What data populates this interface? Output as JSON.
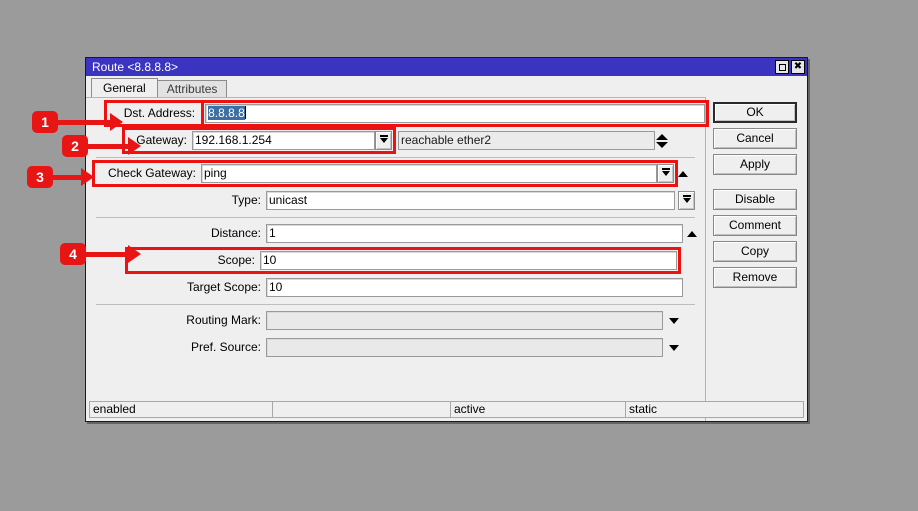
{
  "window": {
    "title": "Route <8.8.8.8>",
    "buttons": {
      "restore": "restore-window",
      "close": "✖"
    }
  },
  "tabs": [
    {
      "label": "General",
      "active": true
    },
    {
      "label": "Attributes",
      "active": false
    }
  ],
  "form": {
    "dst_address": {
      "label": "Dst. Address:",
      "value": "8.8.8.8",
      "selected": true
    },
    "gateway": {
      "label": "Gateway:",
      "value": "192.168.1.254",
      "status": "reachable ether2"
    },
    "check_gateway": {
      "label": "Check Gateway:",
      "value": "ping"
    },
    "type": {
      "label": "Type:",
      "value": "unicast"
    },
    "distance": {
      "label": "Distance:",
      "value": "1"
    },
    "scope": {
      "label": "Scope:",
      "value": "10"
    },
    "target_scope": {
      "label": "Target Scope:",
      "value": "10"
    },
    "routing_mark": {
      "label": "Routing Mark:",
      "value": ""
    },
    "pref_source": {
      "label": "Pref. Source:",
      "value": ""
    }
  },
  "actions": {
    "ok": "OK",
    "cancel": "Cancel",
    "apply": "Apply",
    "disable": "Disable",
    "comment": "Comment",
    "copy": "Copy",
    "remove": "Remove"
  },
  "statusbar": {
    "cells": [
      "enabled",
      "",
      "active",
      "static"
    ]
  },
  "callouts": [
    {
      "number": "1"
    },
    {
      "number": "2"
    },
    {
      "number": "3"
    },
    {
      "number": "4"
    }
  ],
  "colors": {
    "titlebar": "#3b34c0",
    "highlight": "#ee1111",
    "selection": "#3a6ea5",
    "desktop": "#9b9b9b"
  }
}
